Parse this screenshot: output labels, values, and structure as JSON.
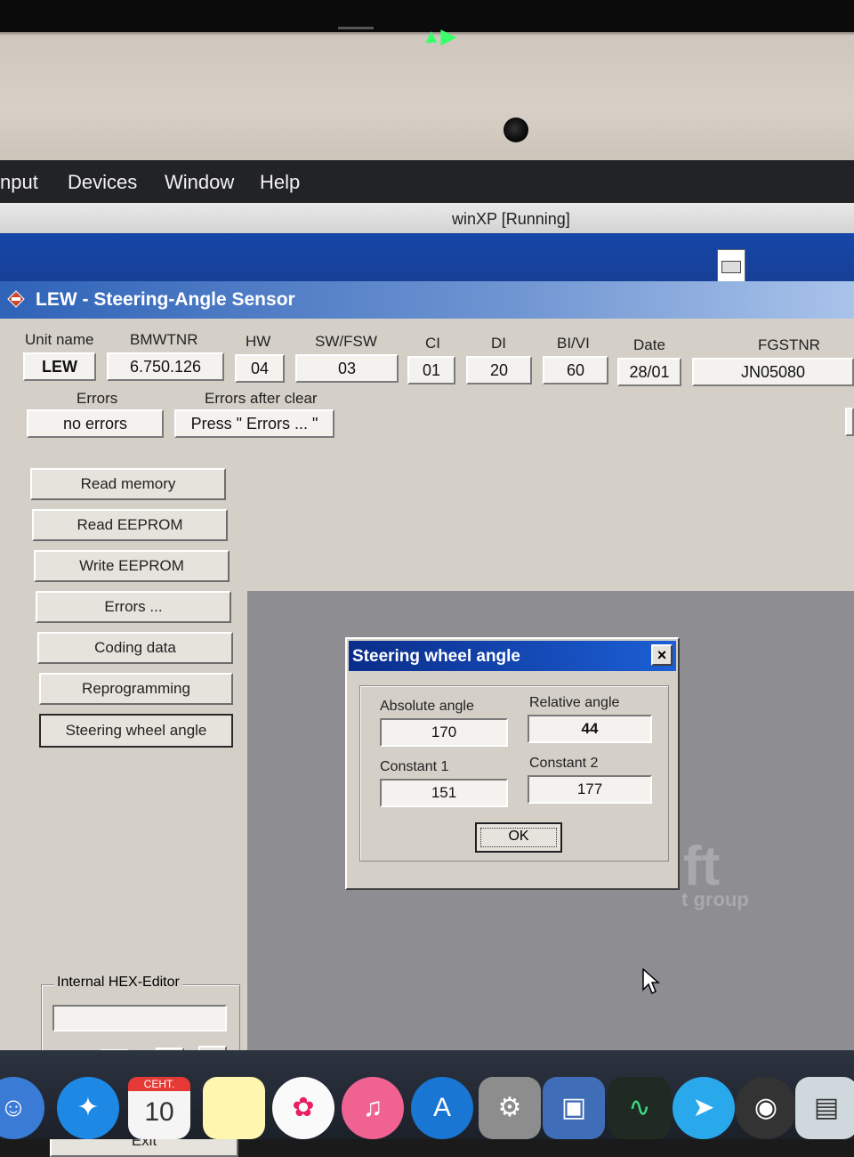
{
  "mac_menu": {
    "items": [
      "nput",
      "Devices",
      "Window",
      "Help"
    ]
  },
  "vbox": {
    "title": "winXP [Running]"
  },
  "app": {
    "title": "LEW - Steering-Angle Sensor",
    "header": {
      "labels": [
        "Unit name",
        "BMWTNR",
        "HW",
        "SW/FSW",
        "CI",
        "DI",
        "BI/VI",
        "Date",
        "FGSTNR"
      ],
      "values": [
        "LEW",
        "6.750.126",
        "04",
        "03",
        "01",
        "20",
        "60",
        "28/01",
        "JN05080"
      ],
      "errors_label": "Errors",
      "errors_value": "no errors",
      "errors_after_clear_label": "Errors after clear",
      "errors_after_clear_value": "Press \" Errors ... \""
    },
    "buttons": [
      "Read memory",
      "Read EEPROM",
      "Write EEPROM",
      "Errors ...",
      "Coding data",
      "Reprogramming",
      "Steering wheel angle"
    ],
    "hex_editor": {
      "label": "Internal HEX-Editor",
      "value": ""
    },
    "exit_label": "Exit",
    "watermark": {
      "main": "ft",
      "sub": "t group"
    }
  },
  "dialog": {
    "title": "Steering wheel angle",
    "close": "×",
    "absolute_angle": {
      "label": "Absolute angle",
      "value": "170"
    },
    "relative_angle": {
      "label": "Relative angle",
      "value": "44"
    },
    "constant1": {
      "label": "Constant 1",
      "value": "151"
    },
    "constant2": {
      "label": "Constant 2",
      "value": "177"
    },
    "ok": "OK"
  },
  "dock": {
    "calendar_month": "СЕНТ.",
    "calendar_day": "10",
    "apps": [
      "finder-icon",
      "safari-icon",
      "calendar-icon",
      "notes-icon",
      "photos-icon",
      "music-icon",
      "app-store-icon",
      "system-preferences-icon",
      "virtualbox-icon",
      "activity-monitor-icon",
      "telegram-icon",
      "camera-icon",
      "screenshot-icon"
    ]
  }
}
